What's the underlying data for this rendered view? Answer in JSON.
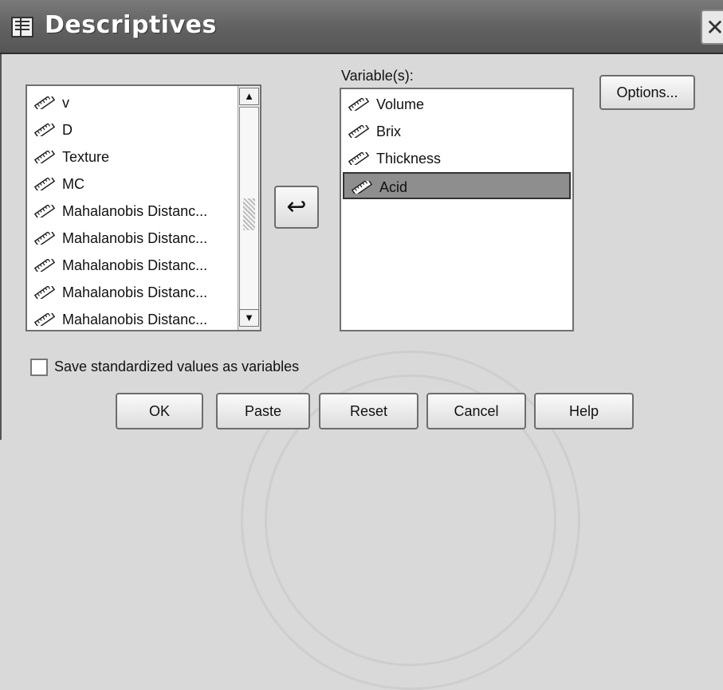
{
  "window": {
    "title": "Descriptives",
    "close_glyph": "✕",
    "icon": "dialog-grid-icon"
  },
  "source_list": {
    "items": [
      {
        "label": "v",
        "icon": "scale-variable-icon"
      },
      {
        "label": "D",
        "icon": "scale-variable-icon"
      },
      {
        "label": "Texture",
        "icon": "scale-variable-icon"
      },
      {
        "label": "MC",
        "icon": "scale-variable-icon"
      },
      {
        "label": "Mahalanobis Distanc...",
        "icon": "scale-variable-icon"
      },
      {
        "label": "Mahalanobis Distanc...",
        "icon": "scale-variable-icon"
      },
      {
        "label": "Mahalanobis Distanc...",
        "icon": "scale-variable-icon"
      },
      {
        "label": "Mahalanobis Distanc...",
        "icon": "scale-variable-icon"
      },
      {
        "label": "Mahalanobis Distanc...",
        "icon": "scale-variable-icon"
      }
    ],
    "scroll_up_glyph": "▲",
    "scroll_down_glyph": "▼"
  },
  "move_button": {
    "glyph": "↩",
    "icon": "move-arrow-icon"
  },
  "variables_list": {
    "label": "Variable(s):",
    "items": [
      {
        "label": "Volume",
        "icon": "scale-variable-icon",
        "selected": false
      },
      {
        "label": "Brix",
        "icon": "scale-variable-icon",
        "selected": false
      },
      {
        "label": "Thickness",
        "icon": "scale-variable-icon",
        "selected": false
      },
      {
        "label": "Acid",
        "icon": "scale-variable-icon",
        "selected": true
      }
    ]
  },
  "options_button": {
    "label": "Options..."
  },
  "save_checkbox": {
    "label": "Save standardized values as variables",
    "checked": false
  },
  "buttons": {
    "ok": "OK",
    "paste": "Paste",
    "reset": "Reset",
    "cancel": "Cancel",
    "help": "Help"
  },
  "colors": {
    "titlebar": "#626262",
    "dialog_bg": "#d9d9d9",
    "selection": "#8e8e8e"
  }
}
